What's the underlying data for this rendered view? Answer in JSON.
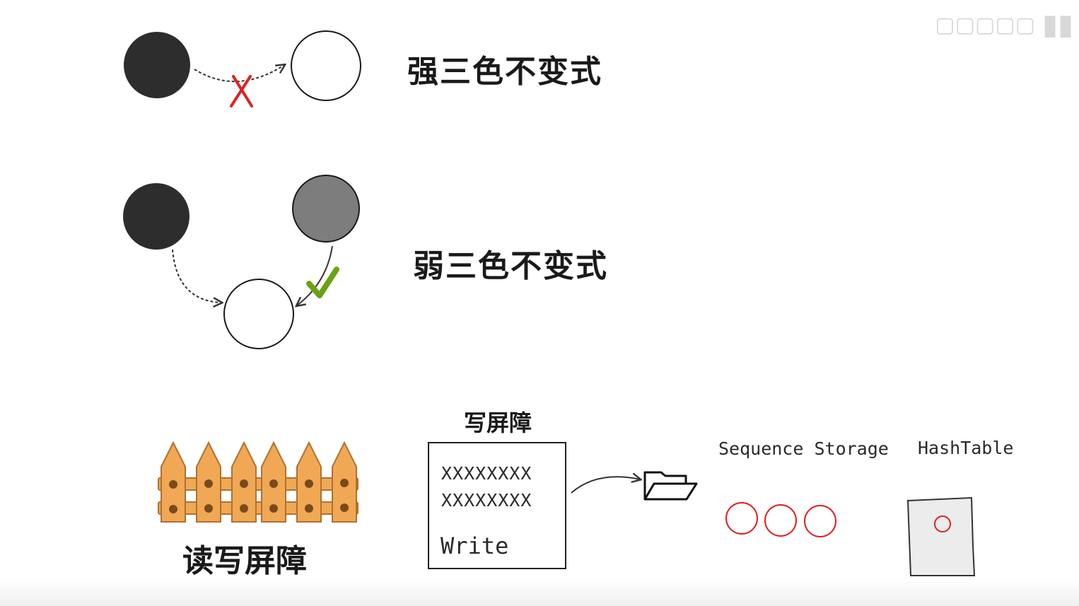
{
  "titles": {
    "strong": "强三色不变式",
    "weak": "弱三色不变式"
  },
  "barriers": {
    "read_write": "读写屏障",
    "write": "写屏障"
  },
  "write_box": {
    "line1": "XXXXXXXX",
    "line2": "XXXXXXXX",
    "action": "Write"
  },
  "storage": {
    "sequence_label": "Sequence Storage",
    "hashtable_label": "HashTable"
  },
  "colors": {
    "black_node": "#2d2d2d",
    "grey_node": "#7d7d7d",
    "white_node": "#ffffff",
    "forbidden_mark": "#e02020",
    "allowed_mark": "#6aa212",
    "fence": "#f0a855",
    "storage_circle": "#e02020",
    "hashtable_paper": "#ececec"
  },
  "icons": {
    "forbidden": "cross-icon",
    "allowed": "check-icon",
    "fence": "fence-icon",
    "folder": "folder-icon",
    "watermark": "channel-watermark"
  }
}
